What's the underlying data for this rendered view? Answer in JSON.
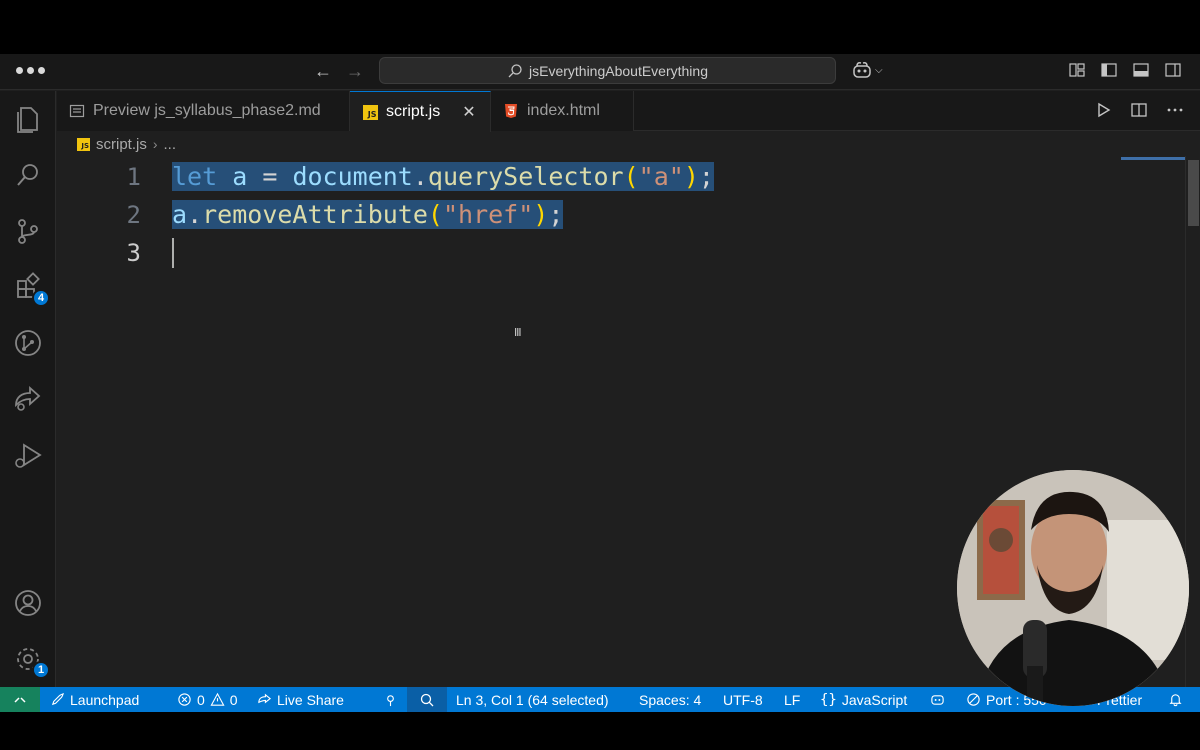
{
  "titlebar": {
    "search_text": "jsEverythingAboutEverything"
  },
  "activity": {
    "extensions_badge": "4",
    "settings_badge": "1"
  },
  "tabs": [
    {
      "label": "Preview js_syllabus_phase2.md",
      "icon": "preview-icon",
      "active": false
    },
    {
      "label": "script.js",
      "icon": "js-file-icon",
      "icon_text": "JS",
      "active": true
    },
    {
      "label": "index.html",
      "icon": "html5-icon",
      "active": false
    }
  ],
  "breadcrumb": {
    "file": "script.js",
    "ellipsis": "..."
  },
  "editor": {
    "line_numbers": [
      "1",
      "2",
      "3"
    ],
    "line1": {
      "kw": "let",
      "var1": "a",
      "op": " = ",
      "obj": "document",
      "dot": ".",
      "fn": "querySelector",
      "open": "(",
      "arg": "\"a\"",
      "close": ")",
      "semi": ";"
    },
    "line2": {
      "obj": "a",
      "dot": ".",
      "fn": "removeAttribute",
      "open": "(",
      "arg": "\"href\"",
      "close": ")",
      "semi": ";"
    }
  },
  "statusbar": {
    "launchpad": "Launchpad",
    "errors": "0",
    "warnings": "0",
    "live_share": "Live Share",
    "position": "Ln 3, Col 1 (64 selected)",
    "spaces": "Spaces: 4",
    "encoding": "UTF-8",
    "eol": "LF",
    "language": "JavaScript",
    "port": "Port : 550",
    "prettier": "Prettier"
  },
  "colors": {
    "accent": "#0078d4",
    "remote": "#16825d",
    "selection": "#264f78"
  }
}
